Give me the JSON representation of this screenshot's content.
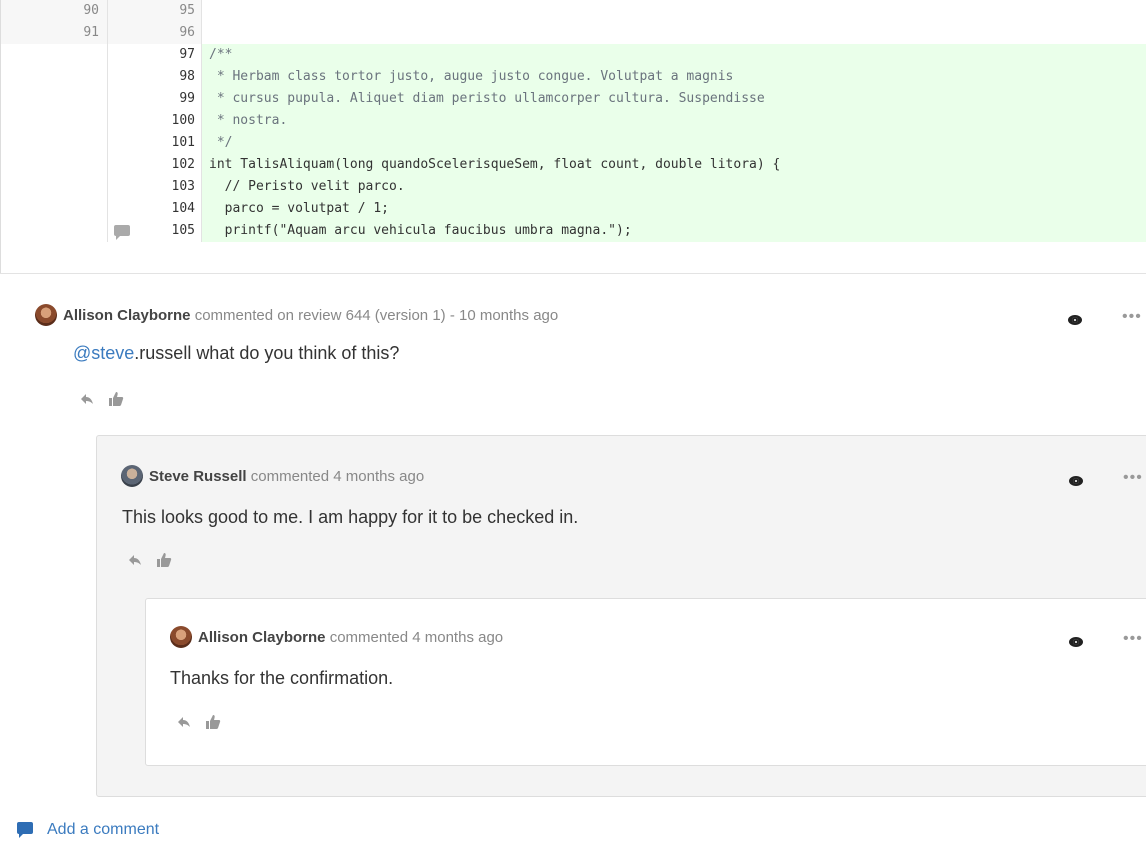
{
  "code": {
    "lines": [
      {
        "old": "90",
        "new": "95",
        "added": false,
        "text": ""
      },
      {
        "old": "91",
        "new": "96",
        "added": false,
        "text": ""
      },
      {
        "old": "",
        "new": "97",
        "added": true,
        "text": "/**"
      },
      {
        "old": "",
        "new": "98",
        "added": true,
        "text": " * Herbam class tortor justo, augue justo congue. Volutpat a magnis"
      },
      {
        "old": "",
        "new": "99",
        "added": true,
        "text": " * cursus pupula. Aliquet diam peristo ullamcorper cultura. Suspendisse"
      },
      {
        "old": "",
        "new": "100",
        "added": true,
        "text": " * nostra."
      },
      {
        "old": "",
        "new": "101",
        "added": true,
        "text": " */"
      },
      {
        "old": "",
        "new": "102",
        "added": true,
        "text": "int TalisAliquam(long quandoScelerisqueSem, float count, double litora) {"
      },
      {
        "old": "",
        "new": "103",
        "added": true,
        "text": "  // Peristo velit parco."
      },
      {
        "old": "",
        "new": "104",
        "added": true,
        "text": "  parco = volutpat / 1;"
      },
      {
        "old": "",
        "new": "105",
        "added": true,
        "text": "  printf(\"Aquam arcu vehicula faucibus umbra magna.\");"
      }
    ]
  },
  "comments": [
    {
      "author": "Allison Clayborne",
      "meta": "commented on review 644 (version 1) - 10 months ago",
      "mention": "@steve",
      "body_rest": ".russell what do you think of this?"
    },
    {
      "author": "Steve Russell",
      "meta": "commented 4 months ago",
      "body": "This looks good to me. I am happy for it to be checked in."
    },
    {
      "author": "Allison Clayborne",
      "meta": "commented 4 months ago",
      "body": "Thanks for the confirmation."
    }
  ],
  "more_label": "•••",
  "add_comment_label": "Add a comment"
}
